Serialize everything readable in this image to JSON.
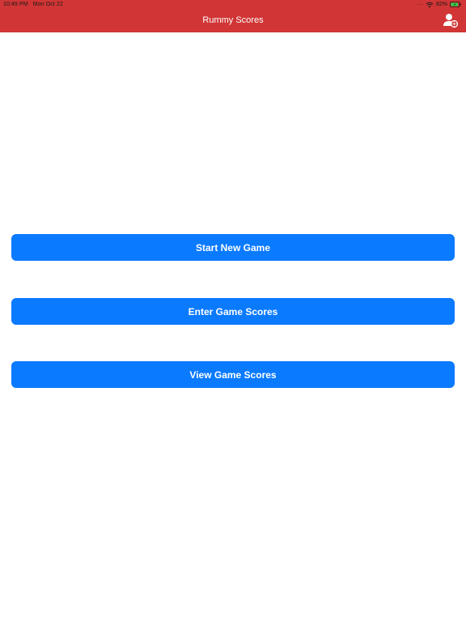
{
  "status_bar": {
    "time": "10:49 PM",
    "date": "Mon Oct 22",
    "signal_dots": "....",
    "battery_percent": "82%",
    "icons": [
      "wifi-icon",
      "battery-charging-icon"
    ]
  },
  "nav_bar": {
    "title": "Rummy Scores",
    "background_color": "#d13535",
    "right_icon": "account-settings-icon"
  },
  "buttons": [
    {
      "label": "Start New Game"
    },
    {
      "label": "Enter Game Scores"
    },
    {
      "label": "View Game Scores"
    }
  ],
  "colors": {
    "button_accent": "#0a7aff",
    "button_text": "#ffffff",
    "background": "#ffffff"
  }
}
